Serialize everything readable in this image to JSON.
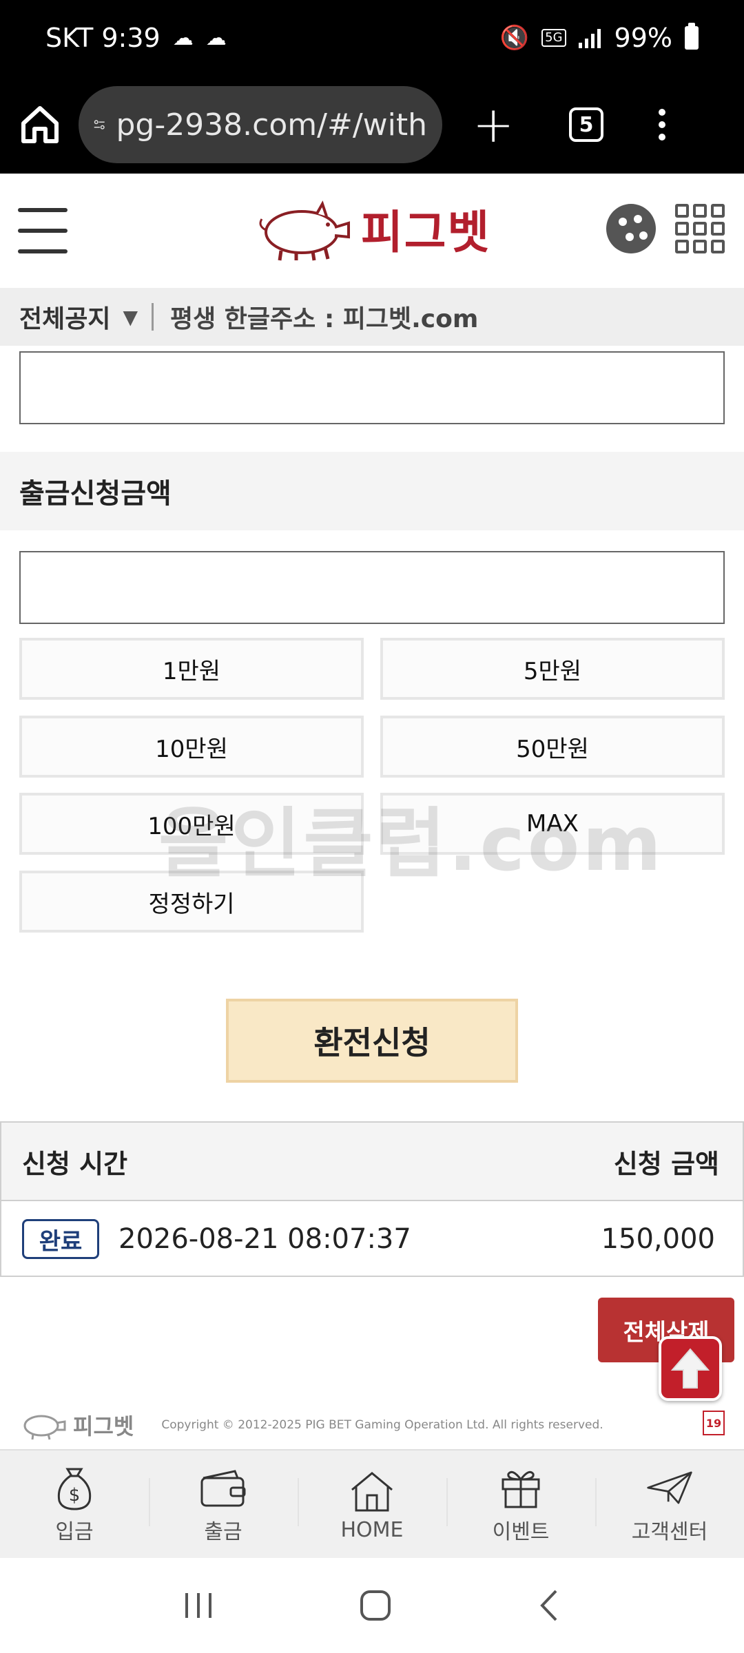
{
  "status_bar": {
    "carrier_time": "SKT 9:39",
    "network": "5G",
    "battery": "99%"
  },
  "browser": {
    "url": "pg-2938.com/#/with",
    "tab_count": "5"
  },
  "header": {
    "logo_text": "피그벳"
  },
  "notice": {
    "category": "전체공지",
    "text": "평생 한글주소 : 피그벳.com"
  },
  "withdraw": {
    "amount_label": "출금신청금액",
    "amount_buttons": [
      "1만원",
      "5만원",
      "10만원",
      "50만원",
      "100만원",
      "MAX",
      "정정하기"
    ],
    "submit_label": "환전신청"
  },
  "history": {
    "col_time": "신청 시간",
    "col_amount": "신청 금액",
    "rows": [
      {
        "status": "완료",
        "time": "2026-08-21 08:07:37",
        "amount": "150,000"
      }
    ],
    "delete_all_label": "전체삭제"
  },
  "watermark": "올인클럽.com",
  "footer": {
    "logo_text": "피그벳",
    "copyright": "Copyright © 2012-2025 PIG BET Gaming Operation Ltd. All rights reserved.",
    "age": "19"
  },
  "bottom_nav": [
    {
      "label": "입금",
      "icon": "money-bag-icon"
    },
    {
      "label": "출금",
      "icon": "wallet-icon"
    },
    {
      "label": "HOME",
      "icon": "home-icon"
    },
    {
      "label": "이벤트",
      "icon": "gift-icon"
    },
    {
      "label": "고객센터",
      "icon": "paper-plane-icon"
    }
  ],
  "colors": {
    "brand_red": "#b21f2d",
    "submit_bg": "#f9e8c6",
    "badge_blue": "#1f3f7a",
    "delete_red": "#b83232"
  }
}
